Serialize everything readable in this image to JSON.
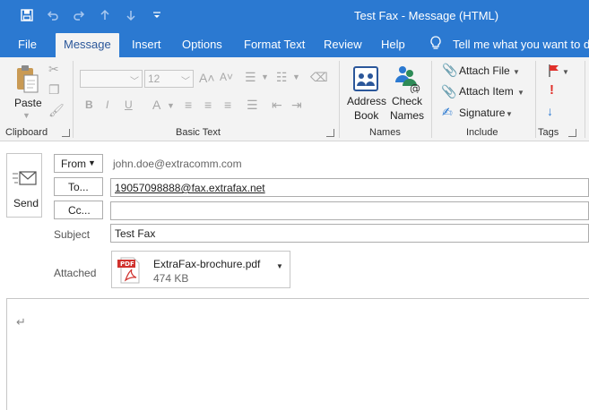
{
  "window": {
    "title": "Test Fax  -  Message (HTML)"
  },
  "quick_access": [
    "save-icon",
    "undo-icon",
    "redo-icon",
    "up-arrow-icon",
    "down-arrow-icon",
    "customize-icon"
  ],
  "tabs": {
    "file": "File",
    "message": "Message",
    "insert": "Insert",
    "options": "Options",
    "format_text": "Format Text",
    "review": "Review",
    "help": "Help",
    "tell_me": "Tell me what you want to do"
  },
  "ribbon": {
    "clipboard": {
      "paste": "Paste",
      "label": "Clipboard"
    },
    "basic_text": {
      "font_size": "12",
      "bold": "B",
      "italic": "I",
      "underline": "U",
      "font_color": "A",
      "label": "Basic Text"
    },
    "names": {
      "address_book": [
        "Address",
        "Book"
      ],
      "check_names": [
        "Check",
        "Names"
      ],
      "label": "Names"
    },
    "include": {
      "attach_file": "Attach File",
      "attach_item": "Attach Item",
      "signature": "Signature",
      "label": "Include"
    },
    "tags": {
      "label": "Tags"
    }
  },
  "compose": {
    "send": "Send",
    "from_label": "From",
    "from_value": "john.doe@extracomm.com",
    "to_label": "To...",
    "to_value": "19057098888@fax.extrafax.net",
    "cc_label": "Cc...",
    "cc_value": "",
    "subject_label": "Subject",
    "subject_value": "Test Fax",
    "attached_label": "Attached",
    "attachment": {
      "name": "ExtraFax-brochure.pdf",
      "size": "474 KB",
      "badge": "PDF"
    },
    "body_marker": "↵"
  },
  "colors": {
    "title_bar": "#2b79d1",
    "ribbon_bg": "#f3f3f3",
    "active_tab_text": "#2b579a",
    "pdf_red": "#d0312d",
    "flag_red": "#e0302a",
    "importance_blue": "#2b79d1"
  }
}
